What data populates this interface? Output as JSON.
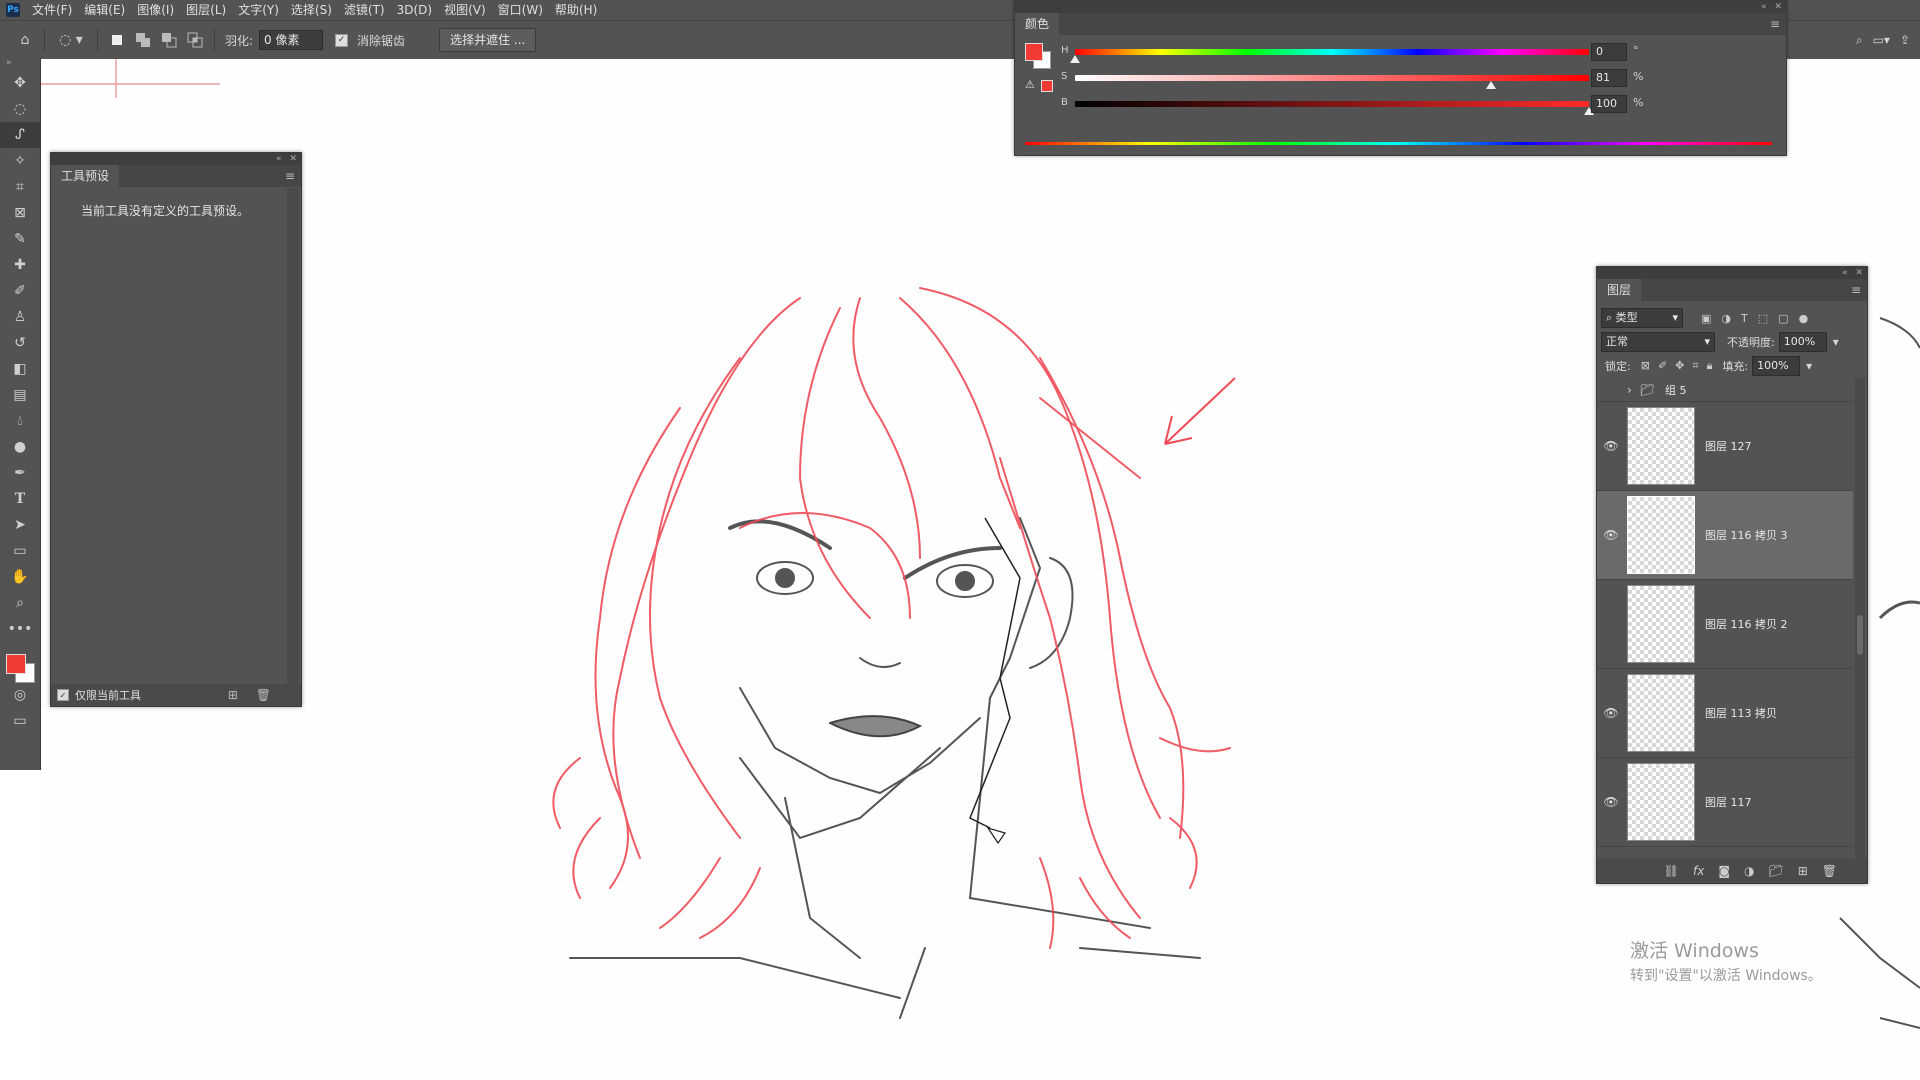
{
  "menu": [
    "文件(F)",
    "编辑(E)",
    "图像(I)",
    "图层(L)",
    "文字(Y)",
    "选择(S)",
    "滤镜(T)",
    "3D(D)",
    "视图(V)",
    "窗口(W)",
    "帮助(H)"
  ],
  "options_bar": {
    "feather_label": "羽化:",
    "feather_value": "0 像素",
    "antialias_label": "消除锯齿",
    "select_mask_button": "选择并遮住 ..."
  },
  "tool_presets": {
    "tab": "工具预设",
    "message": "当前工具没有定义的工具预设。",
    "current_tool_only": "仅限当前工具"
  },
  "color_panel": {
    "tab": "颜色",
    "foreground": "#f23a35",
    "h": {
      "label": "H",
      "value": "0",
      "unit": "°",
      "fraction": 0.0
    },
    "s": {
      "label": "S",
      "value": "81",
      "unit": "%",
      "fraction": 0.81
    },
    "b": {
      "label": "B",
      "value": "100",
      "unit": "%",
      "fraction": 1.0
    }
  },
  "layers_panel": {
    "tab": "图层",
    "filter_kind": "类型",
    "blend_mode": "正常",
    "opacity_label": "不透明度:",
    "opacity_value": "100%",
    "lock_label": "锁定:",
    "fill_label": "填充:",
    "fill_value": "100%",
    "group": "组 5",
    "layers": [
      {
        "name": "图层 127",
        "visible": true,
        "selected": false
      },
      {
        "name": "图层 116 拷贝 3",
        "visible": true,
        "selected": true
      },
      {
        "name": "图层 116 拷贝 2",
        "visible": false,
        "selected": false
      },
      {
        "name": "图层 113 拷贝",
        "visible": true,
        "selected": false
      },
      {
        "name": "图层 117",
        "visible": true,
        "selected": false
      }
    ]
  },
  "watermark": {
    "line1": "激活 Windows",
    "line2": "转到\"设置\"以激活 Windows。"
  },
  "colors": {
    "ui_panel": "#535353",
    "sketch_red": "#ef4a55",
    "sketch_gray": "#444444"
  }
}
